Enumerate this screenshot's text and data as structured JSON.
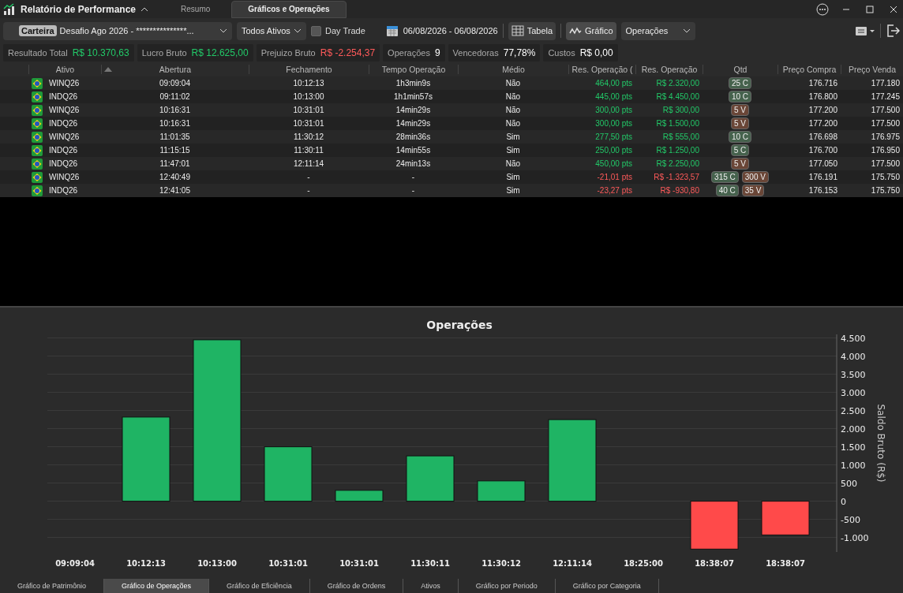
{
  "window": {
    "title": "Relatório de Performance",
    "tabs": [
      {
        "label": "Resumo",
        "selected": false
      },
      {
        "label": "Gráficos e Operações",
        "selected": true
      }
    ]
  },
  "toolbar": {
    "portfolio_tag": "Carteira",
    "portfolio": "Desafio Ago 2026 - ***************...",
    "assets": "Todos Ativos",
    "day_trade": {
      "label": "Day Trade",
      "checked": false
    },
    "date_range": "06/08/2026 - 06/08/2026",
    "views": [
      {
        "label": "Tabela",
        "kind": "table",
        "selected": false
      },
      {
        "label": "Gráfico",
        "kind": "chart",
        "selected": true
      }
    ],
    "chart_type": "Operações"
  },
  "stats": [
    {
      "label": "Resultado Total",
      "value": "R$ 10.370,63",
      "color": "#22c968"
    },
    {
      "label": "Lucro Bruto",
      "value": "R$ 12.625,00",
      "color": "#22c968"
    },
    {
      "label": "Prejuizo Bruto",
      "value": "R$ -2.254,37",
      "color": "#ff5a5a"
    },
    {
      "label": "Operações",
      "value": "9",
      "color": "#ffffff"
    },
    {
      "label": "Vencedoras",
      "value": "77,78%",
      "color": "#ffffff"
    },
    {
      "label": "Custos",
      "value": "R$ 0,00",
      "color": "#ffffff"
    }
  ],
  "table": {
    "columns": [
      "Ativo",
      "Abertura",
      "Fechamento",
      "Tempo Operação",
      "Médio",
      "Res. Operação (",
      "Res. Operação",
      "Qtd",
      "Preço Compra",
      "Preço Venda"
    ],
    "rows": [
      {
        "asset": "WINQ26",
        "open": "09:09:04",
        "close": "10:12:13",
        "duration": "1h3min9s",
        "average": "Não",
        "points": "464,00 pts",
        "result": "R$ 2.320,00",
        "positive": true,
        "qty": [
          {
            "label": "25 C",
            "color": "#46624d"
          }
        ],
        "buy": "176.716",
        "sell": "177.180"
      },
      {
        "asset": "INDQ26",
        "open": "09:11:02",
        "close": "10:13:00",
        "duration": "1h1min57s",
        "average": "Não",
        "points": "445,00 pts",
        "result": "R$ 4.450,00",
        "positive": true,
        "qty": [
          {
            "label": "10 C",
            "color": "#46624d"
          }
        ],
        "buy": "176.800",
        "sell": "177.245"
      },
      {
        "asset": "WINQ26",
        "open": "10:16:31",
        "close": "10:31:01",
        "duration": "14min29s",
        "average": "Não",
        "points": "300,00 pts",
        "result": "R$ 300,00",
        "positive": true,
        "qty": [
          {
            "label": "5 V",
            "color": "#6a4637"
          }
        ],
        "buy": "177.200",
        "sell": "177.500"
      },
      {
        "asset": "INDQ26",
        "open": "10:16:31",
        "close": "10:31:01",
        "duration": "14min29s",
        "average": "Não",
        "points": "300,00 pts",
        "result": "R$ 1.500,00",
        "positive": true,
        "qty": [
          {
            "label": "5 V",
            "color": "#6a4637"
          }
        ],
        "buy": "177.200",
        "sell": "177.500"
      },
      {
        "asset": "WINQ26",
        "open": "11:01:35",
        "close": "11:30:12",
        "duration": "28min36s",
        "average": "Sim",
        "points": "277,50 pts",
        "result": "R$ 555,00",
        "positive": true,
        "qty": [
          {
            "label": "10 C",
            "color": "#46624d"
          }
        ],
        "buy": "176.698",
        "sell": "176.975"
      },
      {
        "asset": "INDQ26",
        "open": "11:15:15",
        "close": "11:30:11",
        "duration": "14min55s",
        "average": "Sim",
        "points": "250,00 pts",
        "result": "R$ 1.250,00",
        "positive": true,
        "qty": [
          {
            "label": "5 C",
            "color": "#46624d"
          }
        ],
        "buy": "176.700",
        "sell": "176.950"
      },
      {
        "asset": "INDQ26",
        "open": "11:47:01",
        "close": "12:11:14",
        "duration": "24min13s",
        "average": "Não",
        "points": "450,00 pts",
        "result": "R$ 2.250,00",
        "positive": true,
        "qty": [
          {
            "label": "5 V",
            "color": "#6a4637"
          }
        ],
        "buy": "177.050",
        "sell": "177.500"
      },
      {
        "asset": "WINQ26",
        "open": "12:40:49",
        "close": "-",
        "duration": "-",
        "average": "Sim",
        "points": "-21,01 pts",
        "result": "R$ -1.323,57",
        "positive": false,
        "qty": [
          {
            "label": "315 C",
            "color": "#46624d"
          },
          {
            "label": "300 V",
            "color": "#6a4637"
          }
        ],
        "buy": "176.191",
        "sell": "175.750"
      },
      {
        "asset": "INDQ26",
        "open": "12:41:05",
        "close": "-",
        "duration": "-",
        "average": "Sim",
        "points": "-23,27 pts",
        "result": "R$ -930,80",
        "positive": false,
        "qty": [
          {
            "label": "40 C",
            "color": "#46624d"
          },
          {
            "label": "35 V",
            "color": "#6a4637"
          }
        ],
        "buy": "176.153",
        "sell": "175.750"
      }
    ]
  },
  "chart": {
    "chart_data": {
      "type": "bar",
      "title": "Operações",
      "ylabel": "Saldo Bruto (R$)",
      "categories": [
        "09:09:04",
        "10:12:13",
        "10:13:00",
        "10:31:01",
        "10:31:01",
        "11:30:11",
        "11:30:12",
        "12:11:14",
        "18:25:00",
        "18:38:07",
        "18:38:07"
      ],
      "series": [
        {
          "color": "#1fb464",
          "values": [
            null,
            2320,
            4450,
            1500,
            300,
            1250,
            560,
            2250,
            null,
            null,
            null
          ]
        },
        {
          "color": "#ff4a4a",
          "values": [
            null,
            null,
            null,
            null,
            null,
            null,
            null,
            null,
            null,
            -1320,
            -930
          ]
        }
      ],
      "grid": true,
      "ylim": [
        -1400,
        4600
      ],
      "yticks": [
        {
          "value": -1000,
          "label": "-1.000"
        },
        {
          "value": -500,
          "label": "-500"
        },
        {
          "value": 0,
          "label": "0"
        },
        {
          "value": 500,
          "label": "500"
        },
        {
          "value": 1000,
          "label": "1.000"
        },
        {
          "value": 1500,
          "label": "1.500"
        },
        {
          "value": 2000,
          "label": "2.000"
        },
        {
          "value": 2500,
          "label": "2.500"
        },
        {
          "value": 3000,
          "label": "3.000"
        },
        {
          "value": 3500,
          "label": "3.500"
        },
        {
          "value": 4000,
          "label": "4.000"
        },
        {
          "value": 4500,
          "label": "4.500"
        }
      ]
    }
  },
  "bottom_tabs": [
    {
      "label": "Gráfico de Patrimônio",
      "selected": false
    },
    {
      "label": "Gráfico de Operações",
      "selected": true
    },
    {
      "label": "Gráfico de Eficiência",
      "selected": false
    },
    {
      "label": "Gráfico de Ordens",
      "selected": false
    },
    {
      "label": "Ativos",
      "selected": false
    },
    {
      "label": "Gráfico por Periodo",
      "selected": false
    },
    {
      "label": "Gráfico por Categoria",
      "selected": false
    }
  ]
}
